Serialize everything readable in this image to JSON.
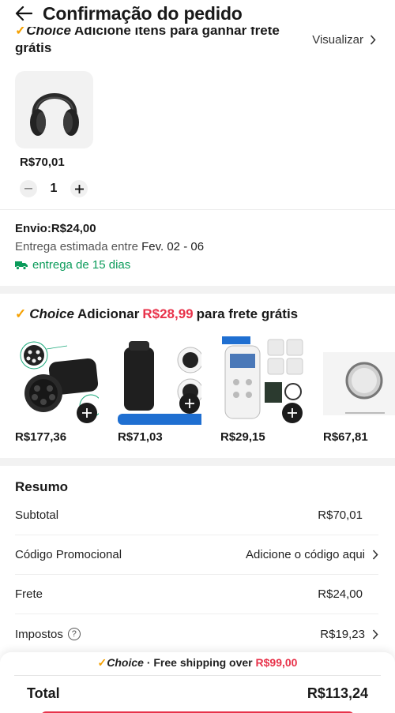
{
  "header": {
    "title": "Confirmação do pedido"
  },
  "cart_group": {
    "choice_label": "Choice",
    "heading_text": "Adicione itens para ganhar frete grátis",
    "view_label": "Visualizar",
    "item": {
      "image": "headphones-product-image",
      "price": "R$70,01",
      "quantity": "1"
    }
  },
  "shipping": {
    "title": "Envio:R$24,00",
    "estimate_prefix": "Entrega estimada entre",
    "estimate_dates": "Fev. 02 - 06",
    "delivery_days": "entrega de 15 dias"
  },
  "choice_promo": {
    "choice_label": "Choice",
    "prefix": "Adicionar",
    "amount": "R$28,99",
    "suffix": "para frete grátis",
    "products": [
      {
        "image": "ev-adapter-product-image",
        "price": "R$177,36"
      },
      {
        "image": "tesla-charger-adapter-product-image",
        "price": "R$71,03"
      },
      {
        "image": "tens-massager-product-image",
        "price": "R$29,15"
      },
      {
        "image": "bep-gadget-product-image",
        "price": "R$67,81"
      }
    ]
  },
  "summary": {
    "title": "Resumo",
    "rows": [
      {
        "label": "Subtotal",
        "value": "R$70,01"
      },
      {
        "label": "Código Promocional",
        "value": "Adicione o código aqui"
      },
      {
        "label": "Frete",
        "value": "R$24,00"
      },
      {
        "label": "Impostos",
        "value": "R$19,23"
      }
    ]
  },
  "bottom_bar": {
    "choice_label": "Choice",
    "shipping_text": "· Free shipping over",
    "shipping_amount": "R$99,00",
    "total_label": "Total",
    "total_value": "R$113,24"
  },
  "colors": {
    "accent_red": "#e8324a",
    "choice_check": "#f5a000",
    "delivery_green": "#0a9b5a"
  }
}
